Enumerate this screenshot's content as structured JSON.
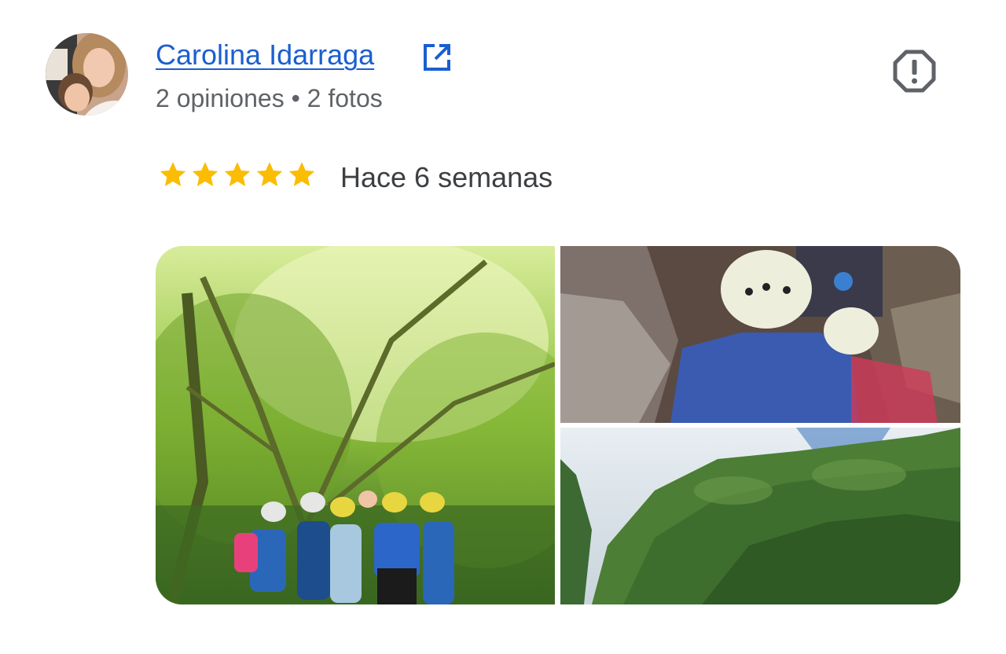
{
  "reviewer": {
    "name": "Carolina Idarraga",
    "avatar_icon": "profile-photo",
    "external_link_icon": "open-in-new-icon"
  },
  "review": {
    "meta": "2 opiniones • 2 fotos",
    "rating": 5,
    "max_rating": 5,
    "date": "Hace 6 semanas",
    "report_icon": "report-icon"
  },
  "photos": [
    {
      "subject": "group with helmets and life vests in green forest"
    },
    {
      "subject": "people with helmets walking through rocky cave"
    },
    {
      "subject": "green forested cliff under blue sky"
    }
  ],
  "colors": {
    "link": "#1a5fd0",
    "meta_text": "#5f6368",
    "star": "#fbbc04",
    "icon_gray": "#5f6368"
  }
}
